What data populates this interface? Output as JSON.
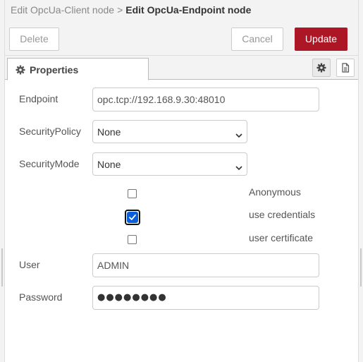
{
  "breadcrumb": {
    "parent": "Edit OpcUa-Client node",
    "separator": ">",
    "current": "Edit OpcUa-Endpoint node"
  },
  "toolbar": {
    "delete_label": "Delete",
    "cancel_label": "Cancel",
    "update_label": "Update"
  },
  "tabs": {
    "properties_label": "Properties"
  },
  "form": {
    "endpoint_label": "Endpoint",
    "endpoint_value": "opc.tcp://192.168.9.30:48010",
    "security_policy_label": "SecurityPolicy",
    "security_policy_value": "None",
    "security_mode_label": "SecurityMode",
    "security_mode_value": "None",
    "anonymous_label": "Anonymous",
    "anonymous_checked": false,
    "use_credentials_label": "use credentials",
    "use_credentials_checked": true,
    "user_certificate_label": "user certificate",
    "user_certificate_checked": false,
    "user_label": "User",
    "user_value": "ADMIN",
    "password_label": "Password",
    "password_masked": "●●●●●●●●"
  },
  "colors": {
    "accent": "#ad1625",
    "checkbox_checked": "#0a5ed7",
    "header_bg": "#f3f3f3"
  },
  "icons": [
    "gear-icon",
    "settings-gear-icon",
    "description-icon",
    "chevron-down-icon",
    "checkmark-icon"
  ]
}
